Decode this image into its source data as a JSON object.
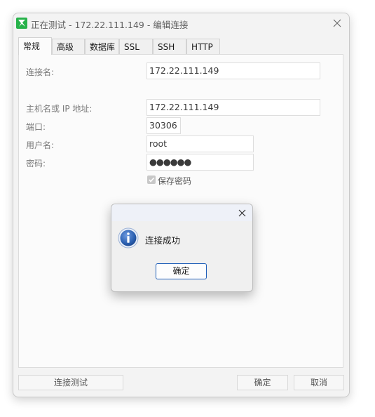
{
  "window": {
    "title": "正在测试 - 172.22.111.149 - 编辑连接"
  },
  "tabs": [
    {
      "label": "常规",
      "active": true
    },
    {
      "label": "高级",
      "active": false
    },
    {
      "label": "数据库",
      "active": false
    },
    {
      "label": "SSL",
      "active": false
    },
    {
      "label": "SSH",
      "active": false
    },
    {
      "label": "HTTP",
      "active": false
    }
  ],
  "form": {
    "connection_name_label": "连接名:",
    "connection_name_value": "172.22.111.149",
    "host_label": "主机名或 IP 地址:",
    "host_value": "172.22.111.149",
    "port_label": "端口:",
    "port_value": "30306",
    "user_label": "用户名:",
    "user_value": "root",
    "password_label": "密码:",
    "password_value": "●●●●●●",
    "save_password_label": "保存密码",
    "save_password_checked": true
  },
  "buttons": {
    "test_connection": "连接测试",
    "ok": "确定",
    "cancel": "取消"
  },
  "dialog": {
    "message": "连接成功",
    "ok": "确定",
    "icon": "info-icon"
  },
  "colors": {
    "app_icon": "#27b24a",
    "dialog_button_border": "#1f5fb8",
    "info_icon": "#2a5fb0"
  }
}
